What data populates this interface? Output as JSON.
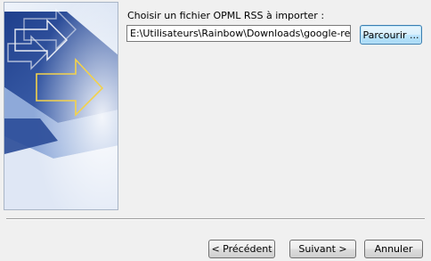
{
  "import_step": {
    "prompt_label": "Choisir un fichier OPML RSS à importer :",
    "file_path_value": "E:\\Utilisateurs\\Rainbow\\Downloads\\google-reader-s",
    "browse_button_label": "Parcourir ..."
  },
  "navigation": {
    "previous_label": "< Précédent",
    "next_label": "Suivant >",
    "cancel_label": "Annuler"
  },
  "banner": {
    "icon": "outlook-wizard-arrows-graphic",
    "colors": {
      "dark_blue": "#2b4f9a",
      "mid_blue": "#5b7fc4",
      "light_blue": "#c7d6ec",
      "accent_yellow": "#f3d24a"
    }
  }
}
